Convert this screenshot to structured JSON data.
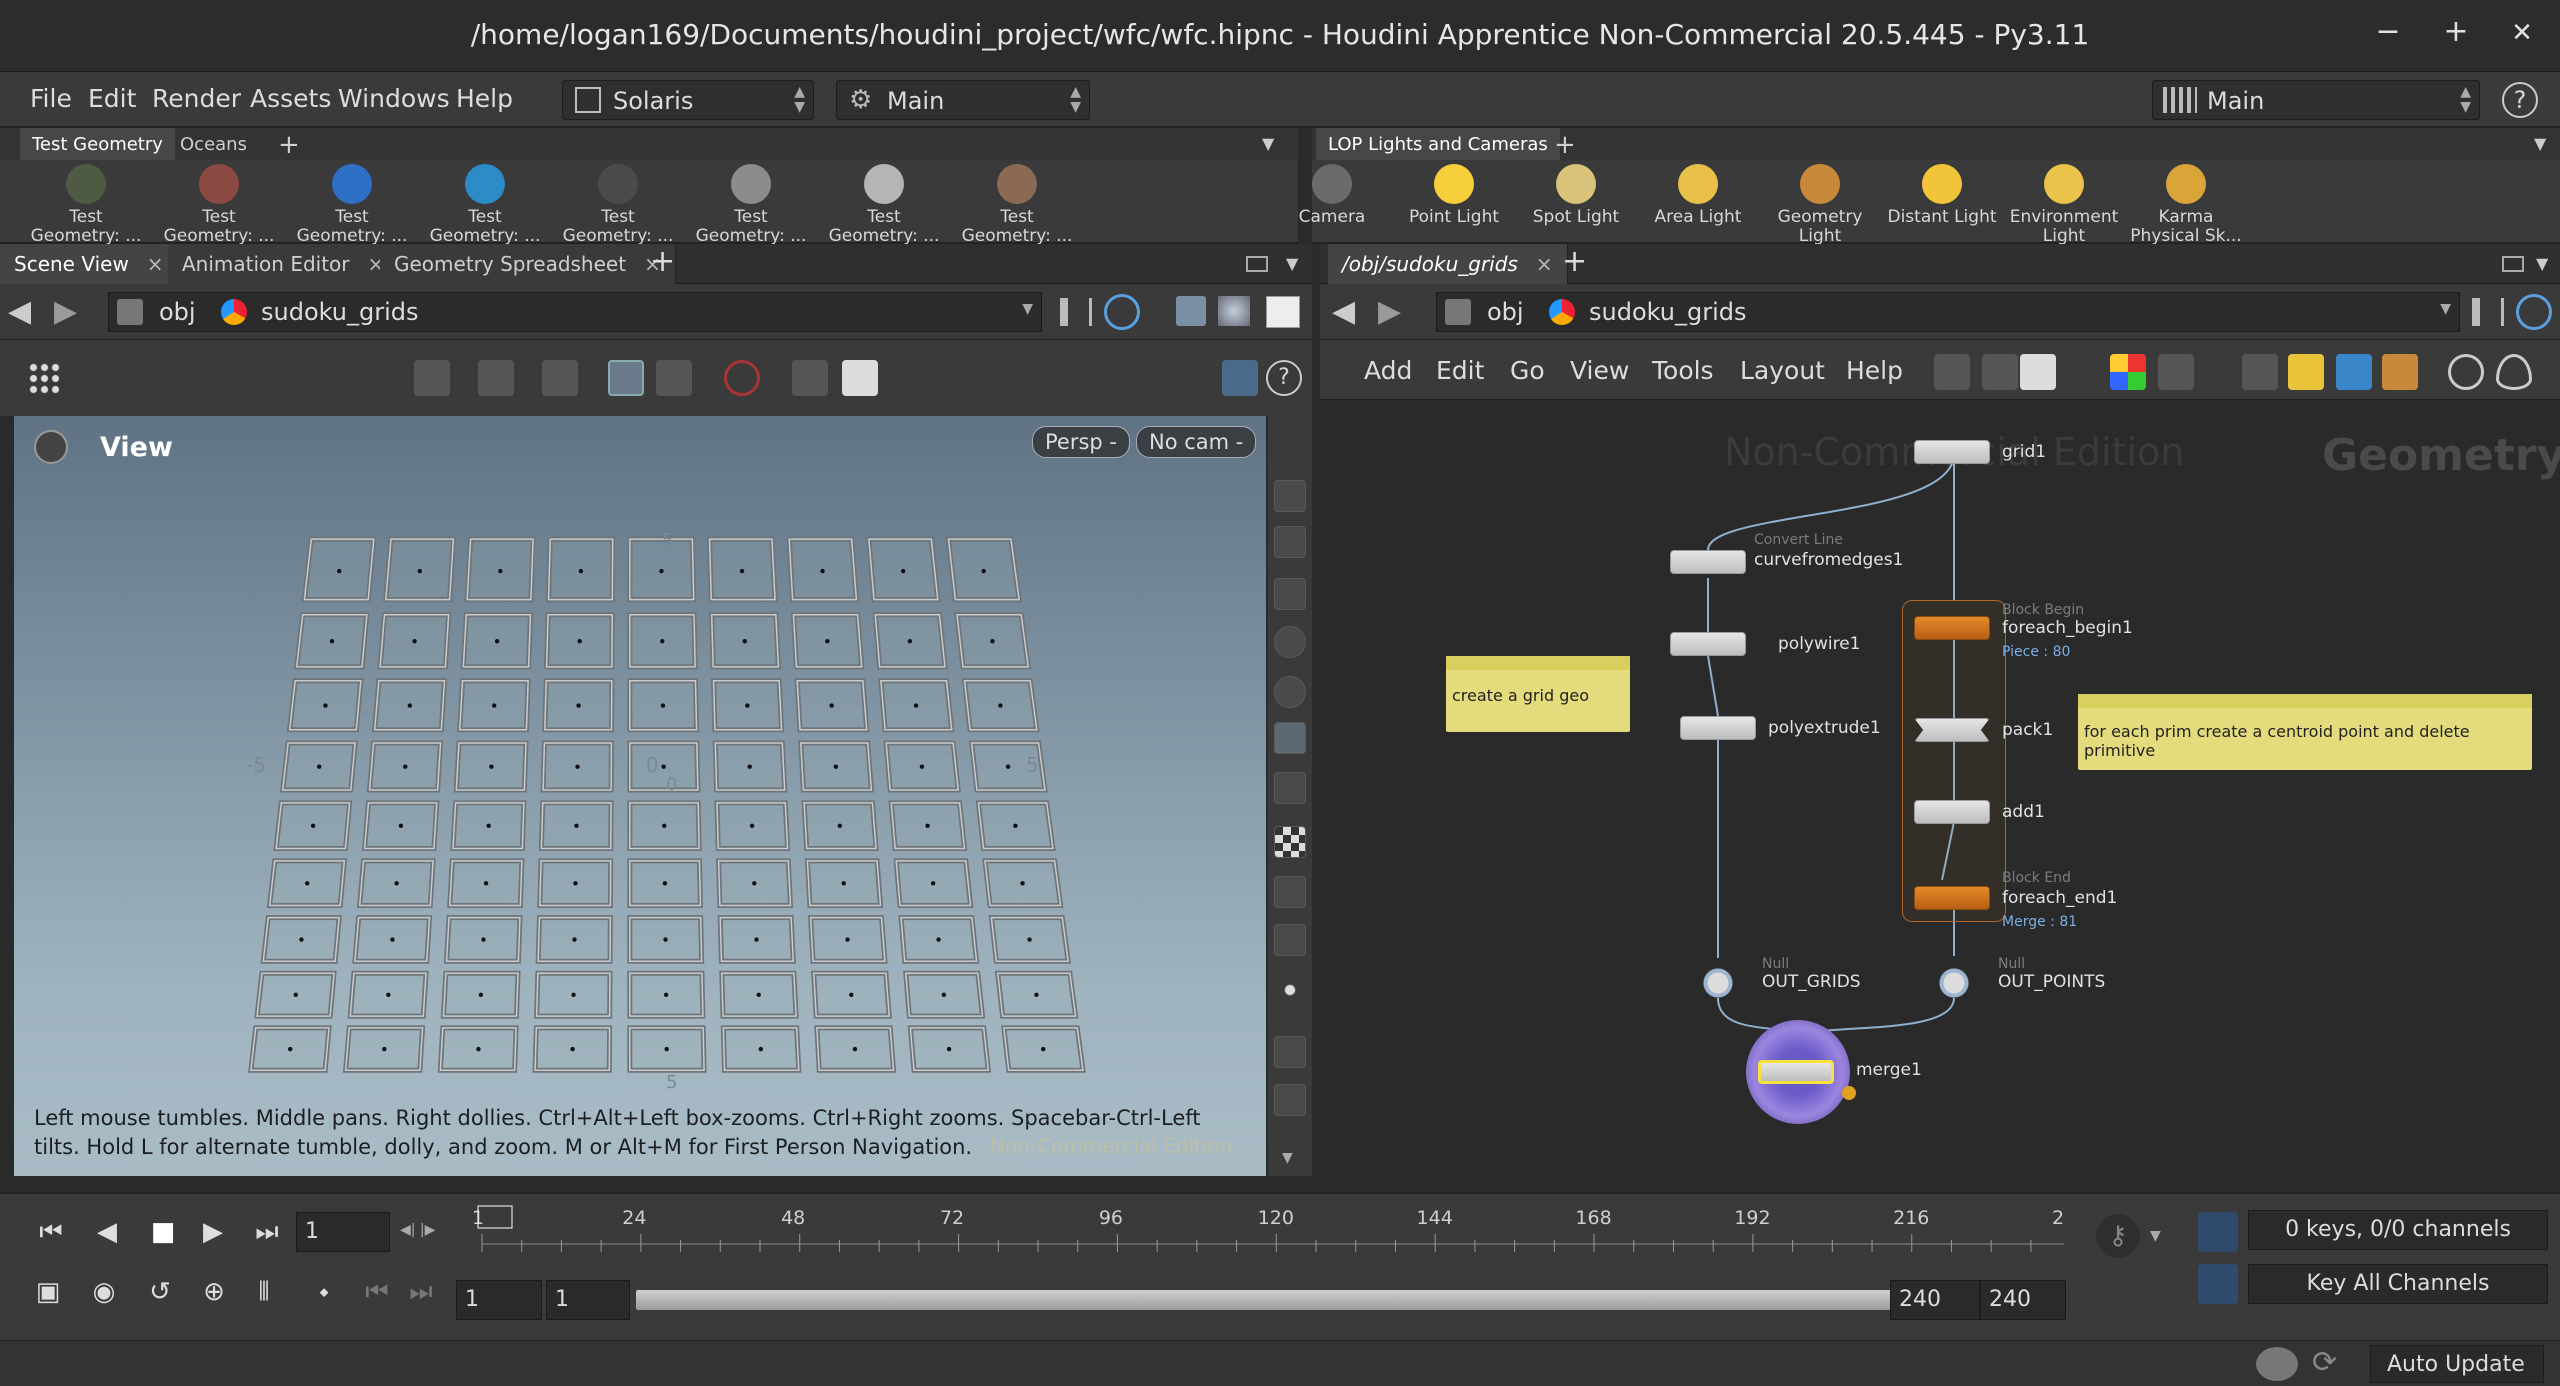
{
  "window": {
    "title": "/home/logan169/Documents/houdini_project/wfc/wfc.hipnc - Houdini Apprentice Non-Commercial 20.5.445 - Py3.11",
    "minimize": "−",
    "maximize": "+",
    "close": "✕"
  },
  "menu": {
    "items": [
      "File",
      "Edit",
      "Render",
      "Assets",
      "Windows",
      "Help"
    ],
    "desktop": "Solaris",
    "context": "Main",
    "right_desktop": "Main",
    "help": "?"
  },
  "shelf_left": {
    "tabs": [
      "Test Geometry",
      "Oceans"
    ],
    "add": "+",
    "tools": [
      {
        "label": "Test\nGeometry: ...",
        "color": "#4f5a43"
      },
      {
        "label": "Test\nGeometry: ...",
        "color": "#8a4a42"
      },
      {
        "label": "Test\nGeometry: ...",
        "color": "#2d6fc6"
      },
      {
        "label": "Test\nGeometry: ...",
        "color": "#2b8cc7"
      },
      {
        "label": "Test\nGeometry: ...",
        "color": "#4b4b4b"
      },
      {
        "label": "Test\nGeometry: ...",
        "color": "#8c8c8c"
      },
      {
        "label": "Test\nGeometry: ...",
        "color": "#b5b5b5"
      },
      {
        "label": "Test\nGeometry: ...",
        "color": "#8a6a55"
      }
    ]
  },
  "shelf_right": {
    "tabs": [
      "LOP Lights and Cameras"
    ],
    "add": "+",
    "tools": [
      {
        "label": "Camera",
        "color": "#6a6a6a"
      },
      {
        "label": "Point Light",
        "color": "#f4cf3a"
      },
      {
        "label": "Spot Light",
        "color": "#d9c27a"
      },
      {
        "label": "Area Light",
        "color": "#e9c14a"
      },
      {
        "label": "Geometry\nLight",
        "color": "#c88a3a"
      },
      {
        "label": "Distant Light",
        "color": "#f1c43a"
      },
      {
        "label": "Environment\nLight",
        "color": "#e9c34a"
      },
      {
        "label": "Karma\nPhysical Sk...",
        "color": "#d9a43a"
      }
    ]
  },
  "left_pane": {
    "tabs": [
      "Scene View",
      "Animation Editor",
      "Geometry Spreadsheet"
    ],
    "close": "×",
    "add": "+",
    "path": [
      "obj",
      "sudoku_grids"
    ],
    "view_label": "View",
    "persp": "Persp -",
    "cam": "No cam -",
    "help_text": "Left mouse tumbles. Middle pans. Right dollies. Ctrl+Alt+Left box-zooms. Ctrl+Right zooms. Spacebar-Ctrl-Left tilts. Hold L for alternate tumble, dolly, and zoom. M or Alt+M for First Person Navigation.",
    "watermark": "Non-Commercial Edition",
    "axis_labels": [
      "-5",
      "0",
      "5",
      "0",
      "5",
      "5"
    ]
  },
  "right_pane": {
    "tab": "/obj/sudoku_grids",
    "path": [
      "obj",
      "sudoku_grids"
    ],
    "menu": [
      "Add",
      "Edit",
      "Go",
      "View",
      "Tools",
      "Layout",
      "Help"
    ],
    "watermark": "Non-Commercial Edition",
    "context": "Geometry"
  },
  "nodes": {
    "grid1": "grid1",
    "curve_type": "Convert Line",
    "curve": "curvefromedges1",
    "polywire": "polywire1",
    "polyextrude": "polyextrude1",
    "begin_type": "Block Begin",
    "begin": "foreach_begin1",
    "begin_info": "Piece : 80",
    "pack": "pack1",
    "add": "add1",
    "end_type": "Block End",
    "end": "foreach_end1",
    "end_info": "Merge : 81",
    "out_grids_type": "Null",
    "out_grids": "OUT_GRIDS",
    "out_points_type": "Null",
    "out_points": "OUT_POINTS",
    "merge": "merge1"
  },
  "stickies": {
    "left": "create a grid geo",
    "right": "for each prim create a centroid  point and delete primitive"
  },
  "timeline": {
    "frame": "1",
    "start_frame": "1",
    "ticks": [
      "1",
      "24",
      "48",
      "72",
      "96",
      "120",
      "144",
      "168",
      "192",
      "216",
      "2"
    ],
    "range_start": "1",
    "range_start2": "1",
    "range_end": "240",
    "range_end2": "240",
    "keys": "0 keys, 0/0 channels",
    "key_all": "Key All Channels"
  },
  "status": {
    "auto_update": "Auto Update"
  }
}
